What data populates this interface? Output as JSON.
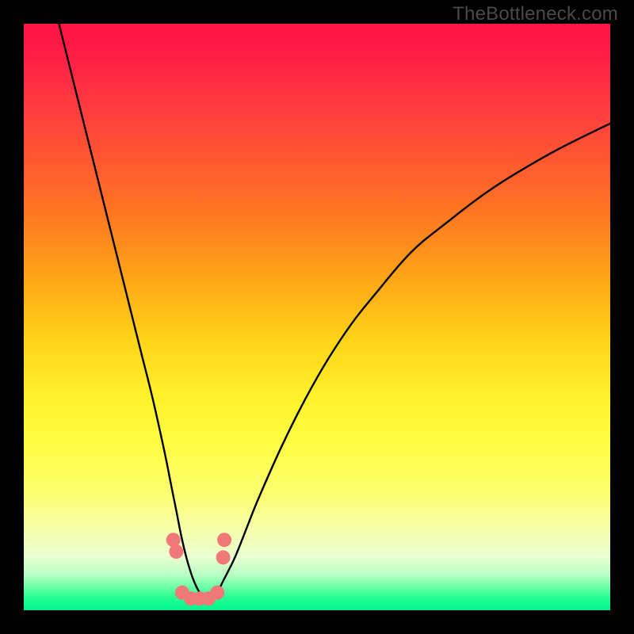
{
  "watermark": "TheBottleneck.com",
  "chart_data": {
    "type": "line",
    "title": "",
    "xlabel": "",
    "ylabel": "",
    "xlim": [
      0,
      100
    ],
    "ylim": [
      0,
      100
    ],
    "gradient_stops": [
      {
        "pos": 0,
        "color": "#ff1445"
      },
      {
        "pos": 6,
        "color": "#ff1f46"
      },
      {
        "pos": 14,
        "color": "#ff3b3f"
      },
      {
        "pos": 24,
        "color": "#ff5a30"
      },
      {
        "pos": 34,
        "color": "#ff7d1f"
      },
      {
        "pos": 44,
        "color": "#ffa816"
      },
      {
        "pos": 54,
        "color": "#ffd419"
      },
      {
        "pos": 64,
        "color": "#fff22a"
      },
      {
        "pos": 72,
        "color": "#fffd45"
      },
      {
        "pos": 80,
        "color": "#fcfe6e"
      },
      {
        "pos": 86,
        "color": "#f6ffa8"
      },
      {
        "pos": 91,
        "color": "#e8ffd0"
      },
      {
        "pos": 94,
        "color": "#b6ffc4"
      },
      {
        "pos": 96,
        "color": "#6dffa8"
      },
      {
        "pos": 98,
        "color": "#21ff91"
      },
      {
        "pos": 100,
        "color": "#00f38f"
      }
    ],
    "series": [
      {
        "name": "bottleneck-curve",
        "color": "#000000",
        "x": [
          6,
          8,
          10,
          12,
          14,
          16,
          18,
          20,
          22,
          24,
          25,
          26,
          27,
          28,
          29,
          30,
          31,
          32,
          33,
          34,
          36,
          38,
          40,
          44,
          48,
          52,
          56,
          60,
          66,
          72,
          80,
          90,
          100
        ],
        "y": [
          100,
          92,
          84,
          76,
          68,
          60,
          52,
          44,
          36,
          27,
          22,
          17,
          12,
          8,
          5,
          3,
          2,
          2,
          3,
          5,
          9,
          14,
          19,
          28,
          36,
          43,
          49,
          54,
          61,
          66,
          72,
          78,
          83
        ]
      },
      {
        "name": "marker-dots",
        "color": "#f07878",
        "type": "scatter",
        "x": [
          25.5,
          26.0,
          27.0,
          28.5,
          30.0,
          31.5,
          33.0,
          34.0,
          34.2
        ],
        "y": [
          12.0,
          10.0,
          3.0,
          2.0,
          2.0,
          2.0,
          3.0,
          9.0,
          12.0
        ]
      }
    ],
    "curve_floor_range_x": [
      28,
      33
    ],
    "curve_min_y": 2
  }
}
